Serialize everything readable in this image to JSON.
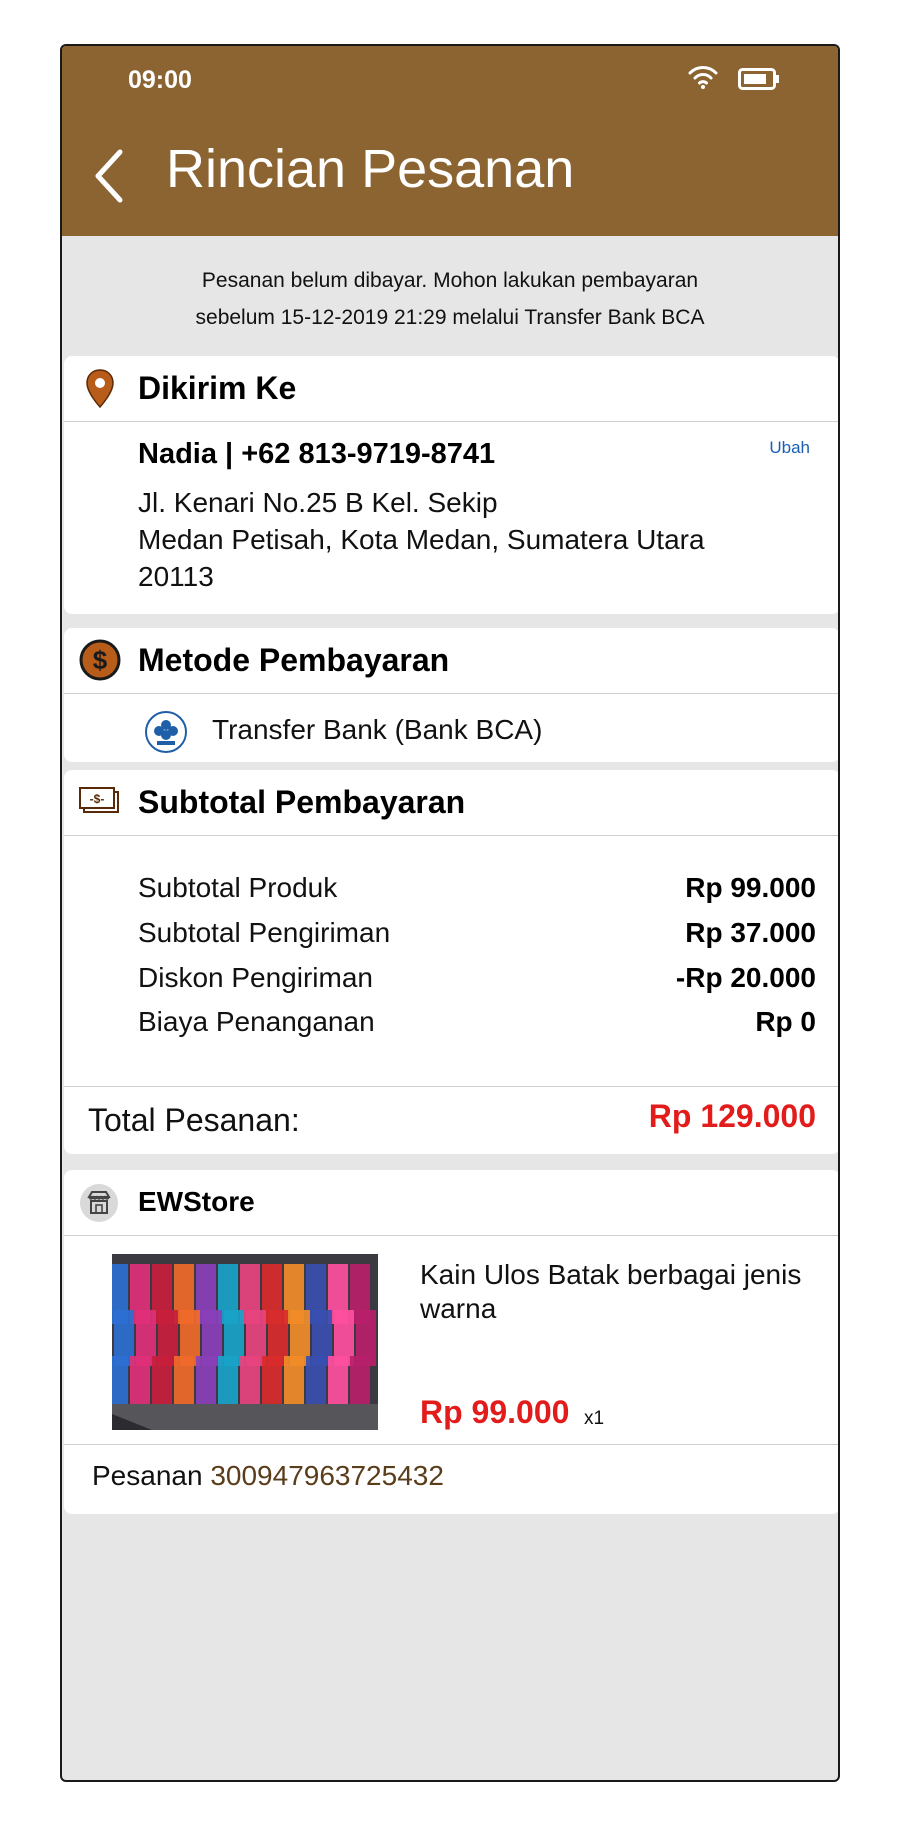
{
  "status_bar": {
    "time": "09:00"
  },
  "header": {
    "title": "Rincian Pesanan"
  },
  "notice": {
    "line1": "Pesanan belum dibayar. Mohon lakukan pembayaran",
    "line2": "sebelum 15-12-2019  21:29 melalui Transfer Bank BCA"
  },
  "shipping": {
    "title": "Dikirim Ke",
    "recipient": "Nadia  |  +62 813-9719-8741",
    "change_label": "Ubah",
    "address_line1": "Jl. Kenari No.25 B Kel. Sekip",
    "address_line2": "Medan Petisah, Kota Medan, Sumatera Utara",
    "address_line3": "20113"
  },
  "payment": {
    "title": "Metode Pembayaran",
    "method": "Transfer Bank (Bank BCA)"
  },
  "subtotal": {
    "title": "Subtotal Pembayaran",
    "rows": [
      {
        "label": "Subtotal Produk",
        "value": "Rp 99.000"
      },
      {
        "label": "Subtotal Pengiriman",
        "value": "Rp 37.000"
      },
      {
        "label": "Diskon Pengiriman",
        "value": "-Rp 20.000"
      },
      {
        "label": "Biaya Penanganan",
        "value": "Rp 0"
      }
    ],
    "total_label": "Total Pesanan:",
    "total_value": "Rp 129.000"
  },
  "store": {
    "name": "EWStore",
    "product_name": "Kain Ulos Batak berbagai jenis warna",
    "product_price": "Rp 99.000",
    "product_qty": "x1",
    "order_label": "Pesanan",
    "order_id": "300947963725432"
  },
  "colors": {
    "header": "#8b6432",
    "price_red": "#e21b1b",
    "link_blue": "#1a5fb4",
    "background_gray": "#e6e6e6"
  },
  "icons": [
    "back-icon",
    "wifi-icon",
    "battery-icon",
    "location-pin-icon",
    "dollar-coin-icon",
    "bank-logo-icon",
    "cash-icon",
    "store-icon"
  ]
}
